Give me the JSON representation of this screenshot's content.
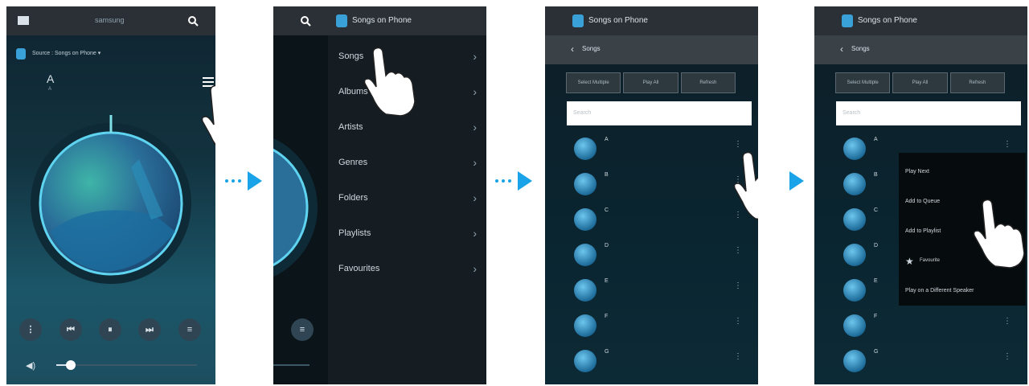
{
  "step1": {
    "header_title": "samsung",
    "source_label": "Source : Songs on Phone ▾",
    "sort_label": "A",
    "sort_sub": "A"
  },
  "step2": {
    "header_title": "Songs on Phone",
    "menu_items": [
      "Songs",
      "Albums",
      "Artists",
      "Genres",
      "Folders",
      "Playlists",
      "Favourites"
    ]
  },
  "step3": {
    "header_title": "Songs on Phone",
    "back_label": "Songs",
    "buttons": [
      "Select Multiple",
      "Play All",
      "Refresh"
    ],
    "search_placeholder": "Search",
    "song_letters": [
      "A",
      "B",
      "C",
      "D",
      "E",
      "F",
      "G"
    ]
  },
  "step4": {
    "header_title": "Songs on Phone",
    "back_label": "Songs",
    "buttons": [
      "Select Multiple",
      "Play All",
      "Refresh"
    ],
    "search_placeholder": "Search",
    "song_letters": [
      "A",
      "B",
      "C",
      "D",
      "E",
      "F",
      "G"
    ],
    "context_menu": [
      "Play Next",
      "Add to Queue",
      "Add to Playlist",
      "Favourite",
      "Play on a Different Speaker"
    ]
  },
  "colors": {
    "arrow": "#1aa3e8",
    "accent": "#4fc0e0"
  }
}
